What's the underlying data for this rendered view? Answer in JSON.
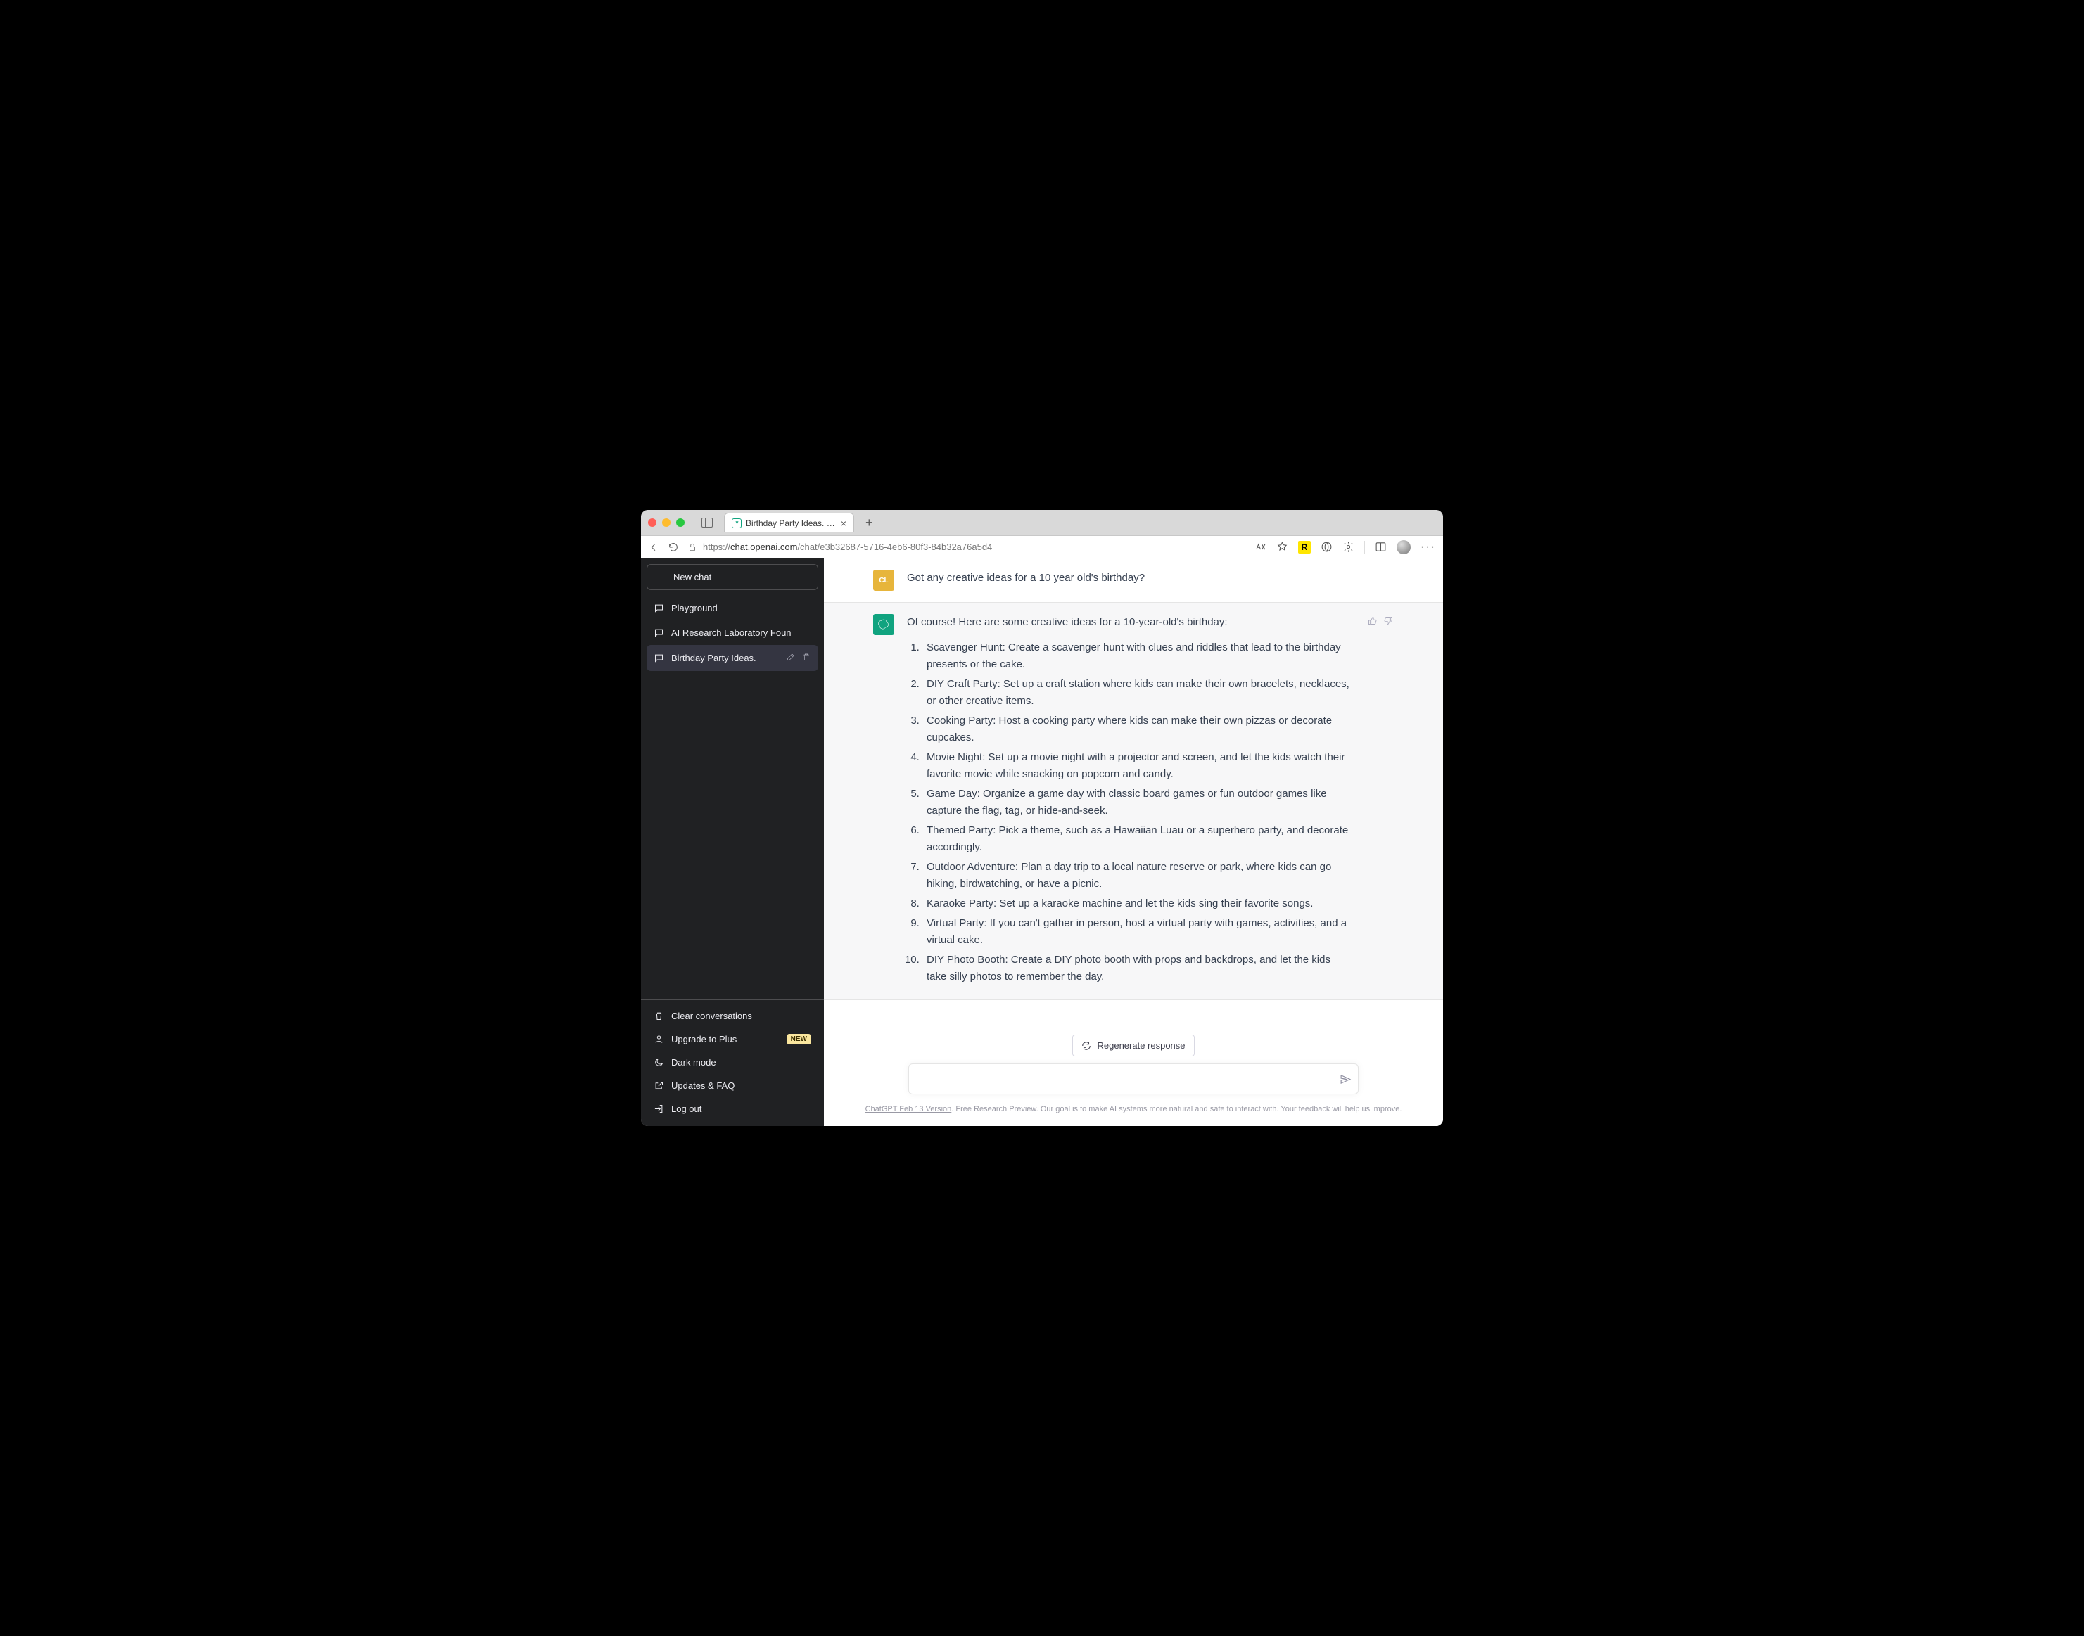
{
  "window": {
    "tab_title": "Birthday Party Ideas. - https://",
    "url_proto": "https://",
    "url_domain": "chat.openai.com",
    "url_path": "/chat/e3b32687-5716-4eb6-80f3-84b32a76a5d4"
  },
  "sidebar": {
    "new_chat": "New chat",
    "items": [
      {
        "label": "Playground",
        "active": false
      },
      {
        "label": "AI Research Laboratory Foun",
        "active": false
      },
      {
        "label": "Birthday Party Ideas.",
        "active": true
      }
    ],
    "bottom": {
      "clear": "Clear conversations",
      "upgrade": "Upgrade to Plus",
      "upgrade_badge": "NEW",
      "dark": "Dark mode",
      "faq": "Updates & FAQ",
      "logout": "Log out"
    }
  },
  "chat": {
    "user_avatar": "CL",
    "user_msg": "Got any creative ideas for a 10 year old's birthday?",
    "ai_intro": "Of course! Here are some creative ideas for a 10-year-old's birthday:",
    "ai_list": [
      "Scavenger Hunt: Create a scavenger hunt with clues and riddles that lead to the birthday presents or the cake.",
      "DIY Craft Party: Set up a craft station where kids can make their own bracelets, necklaces, or other creative items.",
      "Cooking Party: Host a cooking party where kids can make their own pizzas or decorate cupcakes.",
      "Movie Night: Set up a movie night with a projector and screen, and let the kids watch their favorite movie while snacking on popcorn and candy.",
      "Game Day: Organize a game day with classic board games or fun outdoor games like capture the flag, tag, or hide-and-seek.",
      "Themed Party: Pick a theme, such as a Hawaiian Luau or a superhero party, and decorate accordingly.",
      "Outdoor Adventure: Plan a day trip to a local nature reserve or park, where kids can go hiking, birdwatching, or have a picnic.",
      "Karaoke Party: Set up a karaoke machine and let the kids sing their favorite songs.",
      "Virtual Party: If you can't gather in person, host a virtual party with games, activities, and a virtual cake.",
      "DIY Photo Booth: Create a DIY photo booth with props and backdrops, and let the kids take silly photos to remember the day."
    ]
  },
  "controls": {
    "regenerate": "Regenerate response",
    "footer_version": "ChatGPT Feb 13 Version",
    "footer_rest": ". Free Research Preview. Our goal is to make AI systems more natural and safe to interact with. Your feedback will help us improve."
  }
}
